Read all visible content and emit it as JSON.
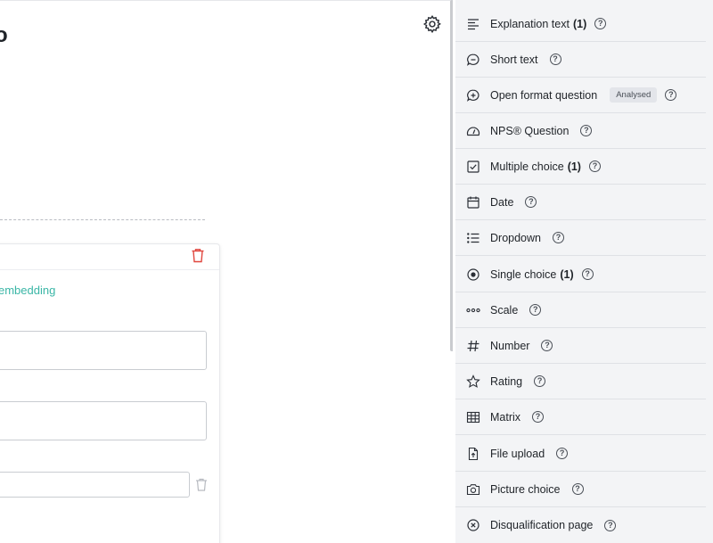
{
  "editor": {
    "title_fragment": "o",
    "embed_link": "embedding"
  },
  "panel": {
    "items": [
      {
        "label": "Explanation text",
        "count": "(1)",
        "icon": "text-align-icon"
      },
      {
        "label": "Short text",
        "count": "",
        "icon": "speech-bubble-icon"
      },
      {
        "label": "Open format question",
        "count": "",
        "badge": "Analysed",
        "icon": "plus-bubble-icon"
      },
      {
        "label": "NPS® Question",
        "count": "",
        "icon": "gauge-icon"
      },
      {
        "label": "Multiple choice",
        "count": "(1)",
        "icon": "checkbox-icon"
      },
      {
        "label": "Date",
        "count": "",
        "icon": "calendar-icon"
      },
      {
        "label": "Dropdown",
        "count": "",
        "icon": "list-icon"
      },
      {
        "label": "Single choice",
        "count": "(1)",
        "icon": "radio-icon"
      },
      {
        "label": "Scale",
        "count": "",
        "icon": "dots-icon"
      },
      {
        "label": "Number",
        "count": "",
        "icon": "hash-icon"
      },
      {
        "label": "Rating",
        "count": "",
        "icon": "star-icon"
      },
      {
        "label": "Matrix",
        "count": "",
        "icon": "grid-icon"
      },
      {
        "label": "File upload",
        "count": "",
        "icon": "file-upload-icon"
      },
      {
        "label": "Picture choice",
        "count": "",
        "icon": "camera-icon"
      },
      {
        "label": "Disqualification page",
        "count": "",
        "icon": "close-circle-icon"
      }
    ],
    "help_glyph": "?"
  },
  "colors": {
    "panel_bg": "#f3f4f6",
    "link": "#3ab6a6",
    "danger": "#e0463e"
  }
}
